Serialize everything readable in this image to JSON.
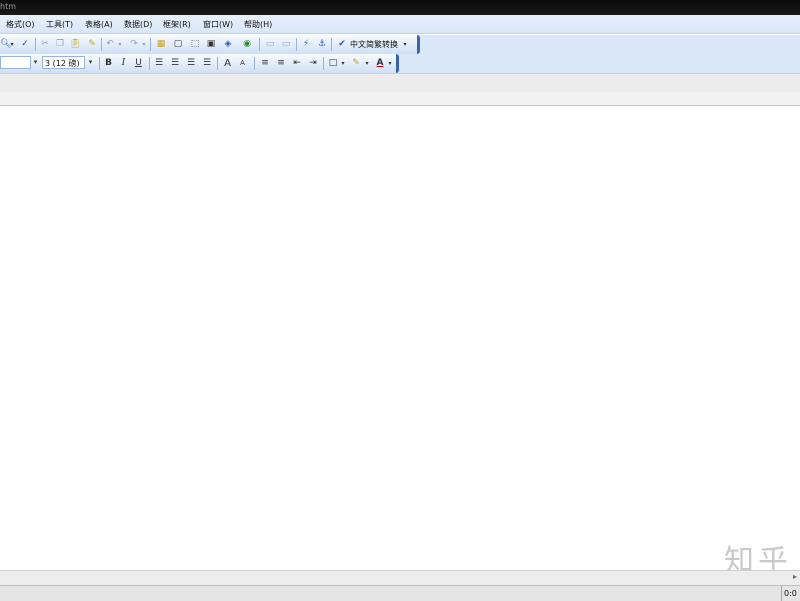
{
  "window": {
    "title": "htm"
  },
  "menubar": {
    "items": [
      "格式(O)",
      "工具(T)",
      "表格(A)",
      "数据(D)",
      "框架(R)",
      "窗口(W)",
      "帮助(H)"
    ]
  },
  "toolbar_standard": {
    "icons": [
      "zoom-icon",
      "spell-check-icon",
      "cut-icon",
      "copy-icon",
      "paste-icon",
      "format-painter-icon",
      "undo-icon",
      "redo-icon",
      "insert-table-icon",
      "frame-icon",
      "picture-icon",
      "web-icon",
      "globe-icon",
      "anchor-icon",
      "link-icon"
    ],
    "dictionary_label": "中文简繁转换"
  },
  "toolbar_format": {
    "font_name": "",
    "font_size": "3 (12 磅)",
    "bold": "B",
    "italic": "I",
    "underline": "U",
    "font_grow": "A",
    "font_shrink": "A"
  },
  "statusbar": {
    "clock": "0:0"
  },
  "watermark": {
    "text": "知乎"
  }
}
